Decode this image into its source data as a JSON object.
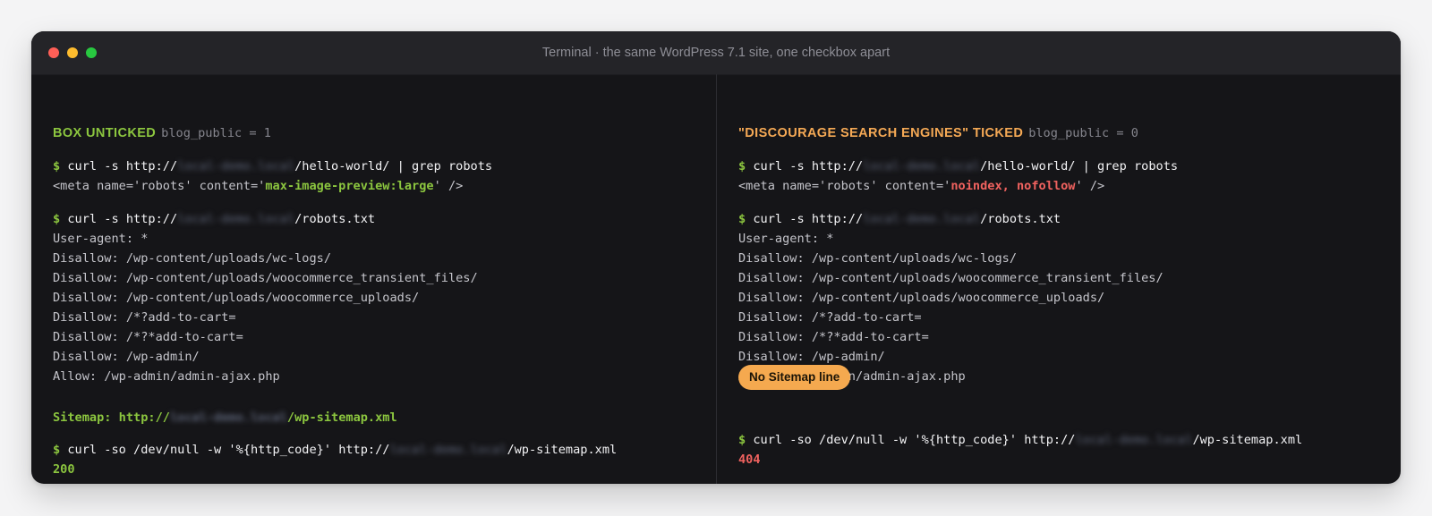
{
  "window": {
    "title": "Terminal · the same WordPress 7.1 site, one checkbox apart"
  },
  "left": {
    "heading": "BOX UNTICKED",
    "variable": "blog_public = 1",
    "prompt": "$",
    "cmd1": "curl -s http://",
    "host": "local-demo.local",
    "cmd1_path": "/hello-world/ | grep robots",
    "meta_prefix": "<meta name='robots' content='",
    "meta_value": "max-image-preview:large",
    "meta_suffix": "' />",
    "cmd2": "curl -s http://",
    "cmd2_path": "/robots.txt",
    "robots": [
      "User-agent: *",
      "Disallow: /wp-content/uploads/wc-logs/",
      "Disallow: /wp-content/uploads/woocommerce_transient_files/",
      "Disallow: /wp-content/uploads/woocommerce_uploads/",
      "Disallow: /*?add-to-cart=",
      "Disallow: /*?*add-to-cart=",
      "Disallow: /wp-admin/",
      "Allow: /wp-admin/admin-ajax.php"
    ],
    "sitemap_prefix": "Sitemap: http://",
    "sitemap_path": "/wp-sitemap.xml",
    "cmd3": "curl -so /dev/null -w '%{http_code}' http://",
    "cmd3_path": "/wp-sitemap.xml",
    "status_code": "200"
  },
  "right": {
    "heading": "\"DISCOURAGE SEARCH ENGINES\" TICKED",
    "variable": "blog_public = 0",
    "prompt": "$",
    "cmd1": "curl -s http://",
    "host": "local-demo.local",
    "cmd1_path": "/hello-world/ | grep robots",
    "meta_prefix": "<meta name='robots' content='",
    "meta_value": "noindex, nofollow",
    "meta_suffix": "' />",
    "cmd2": "curl -s http://",
    "cmd2_path": "/robots.txt",
    "robots": [
      "User-agent: *",
      "Disallow: /wp-content/uploads/wc-logs/",
      "Disallow: /wp-content/uploads/woocommerce_transient_files/",
      "Disallow: /wp-content/uploads/woocommerce_uploads/",
      "Disallow: /*?add-to-cart=",
      "Disallow: /*?*add-to-cart=",
      "Disallow: /wp-admin/",
      "Allow: /wp-admin/admin-ajax.php"
    ],
    "badge": "No Sitemap line",
    "cmd3": "curl -so /dev/null -w '%{http_code}' http://",
    "cmd3_path": "/wp-sitemap.xml",
    "status_code": "404"
  },
  "colors": {
    "green": "#8cc63f",
    "orange": "#f5a955",
    "red": "#f0625f",
    "badge": "#f5a94f",
    "background": "#151518"
  }
}
